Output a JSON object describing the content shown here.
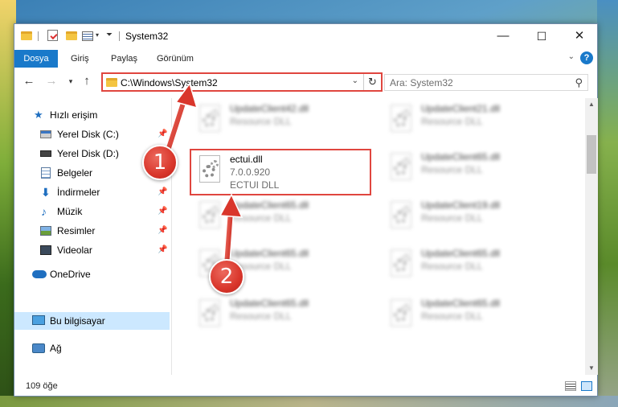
{
  "window": {
    "title": "System32",
    "controls": {
      "minimize": "—",
      "maximize": "☐",
      "close": "✕"
    }
  },
  "ribbon": {
    "tabs": [
      "Dosya",
      "Giriş",
      "Paylaş",
      "Görünüm"
    ],
    "help": "?"
  },
  "address": {
    "path": "C:\\Windows\\System32",
    "search_placeholder": "Ara: System32"
  },
  "nav": {
    "items": [
      {
        "label": "Hızlı erişim",
        "icon": "star-icon"
      },
      {
        "label": "Yerel Disk (C:)",
        "icon": "drive-icon",
        "pinned": true
      },
      {
        "label": "Yerel Disk (D:)",
        "icon": "drive-icon"
      },
      {
        "label": "Belgeler",
        "icon": "documents-icon"
      },
      {
        "label": "İndirmeler",
        "icon": "downloads-icon",
        "pinned": true
      },
      {
        "label": "Müzik",
        "icon": "music-icon",
        "pinned": true
      },
      {
        "label": "Resimler",
        "icon": "pictures-icon",
        "pinned": true
      },
      {
        "label": "Videolar",
        "icon": "videos-icon",
        "pinned": true
      },
      {
        "label": "OneDrive",
        "icon": "onedrive-icon"
      },
      {
        "label": "Bu bilgisayar",
        "icon": "computer-icon",
        "selected": true
      },
      {
        "label": "Ağ",
        "icon": "network-icon"
      }
    ]
  },
  "files": [
    {
      "name": "UpdateClient42.dll",
      "type": "Resource DLL"
    },
    {
      "name": "UpdateClient21.dll",
      "type": "Resource DLL"
    },
    {
      "name": "ectui.dll",
      "version": "7.0.0.920",
      "type": "ECTUI DLL"
    },
    {
      "name": "UpdateClient65.dll",
      "type": "Resource DLL"
    },
    {
      "name": "UpdateClient65.dll",
      "type": "Resource DLL"
    },
    {
      "name": "UpdateClient19.dll",
      "type": "Resource DLL"
    },
    {
      "name": "UpdateClient65.dll",
      "type": "Resource DLL"
    },
    {
      "name": "UpdateClient65.dll",
      "type": "Resource DLL"
    },
    {
      "name": "UpdateClient65.dll",
      "type": "Resource DLL"
    },
    {
      "name": "UpdateClient65.dll",
      "type": "Resource DLL"
    }
  ],
  "status": {
    "count": "109 öğe"
  },
  "annotations": {
    "step1": "1",
    "step2": "2",
    "accent": "#d9362b"
  }
}
